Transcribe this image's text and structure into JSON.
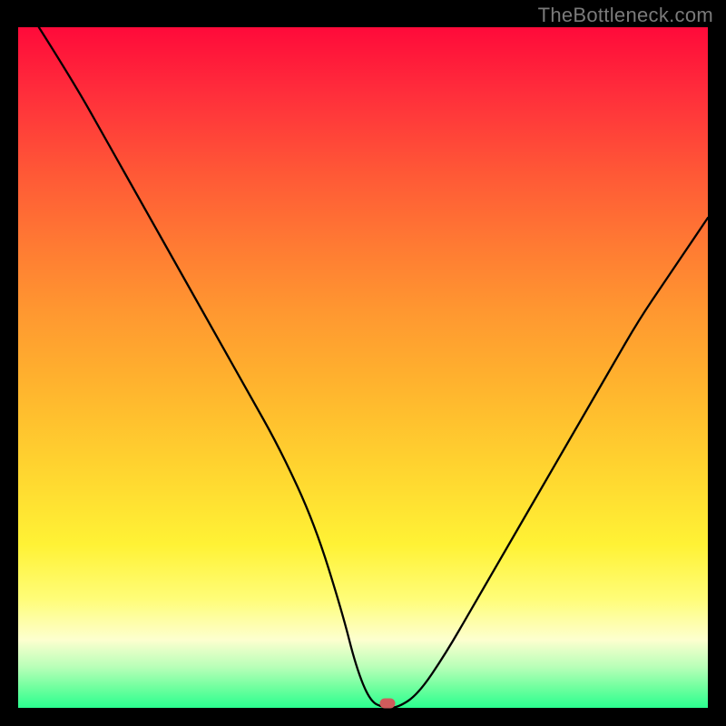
{
  "watermark": "TheBottleneck.com",
  "marker_color": "#cf5b5b",
  "chart_data": {
    "type": "line",
    "title": "",
    "xlabel": "",
    "ylabel": "",
    "xlim": [
      0,
      100
    ],
    "ylim": [
      0,
      100
    ],
    "grid": false,
    "legend": false,
    "series": [
      {
        "name": "bottleneck-curve",
        "x": [
          3,
          8,
          13,
          18,
          23,
          28,
          33,
          38,
          43,
          47,
          49,
          51,
          53,
          55,
          58,
          62,
          66,
          70,
          74,
          78,
          82,
          86,
          90,
          94,
          98,
          100
        ],
        "y": [
          100,
          92,
          83,
          74,
          65,
          56,
          47,
          38,
          27,
          14,
          6,
          1,
          0,
          0,
          2,
          8,
          15,
          22,
          29,
          36,
          43,
          50,
          57,
          63,
          69,
          72
        ]
      }
    ],
    "marker": {
      "x": 53.5,
      "y": 0,
      "color": "#cf5b5b"
    },
    "background_gradient": {
      "direction": "vertical",
      "stops": [
        {
          "pos": 0.0,
          "color": "#ff0a3a"
        },
        {
          "pos": 0.5,
          "color": "#ffb22e"
        },
        {
          "pos": 0.8,
          "color": "#fff235"
        },
        {
          "pos": 1.0,
          "color": "#2aff8f"
        }
      ]
    }
  }
}
